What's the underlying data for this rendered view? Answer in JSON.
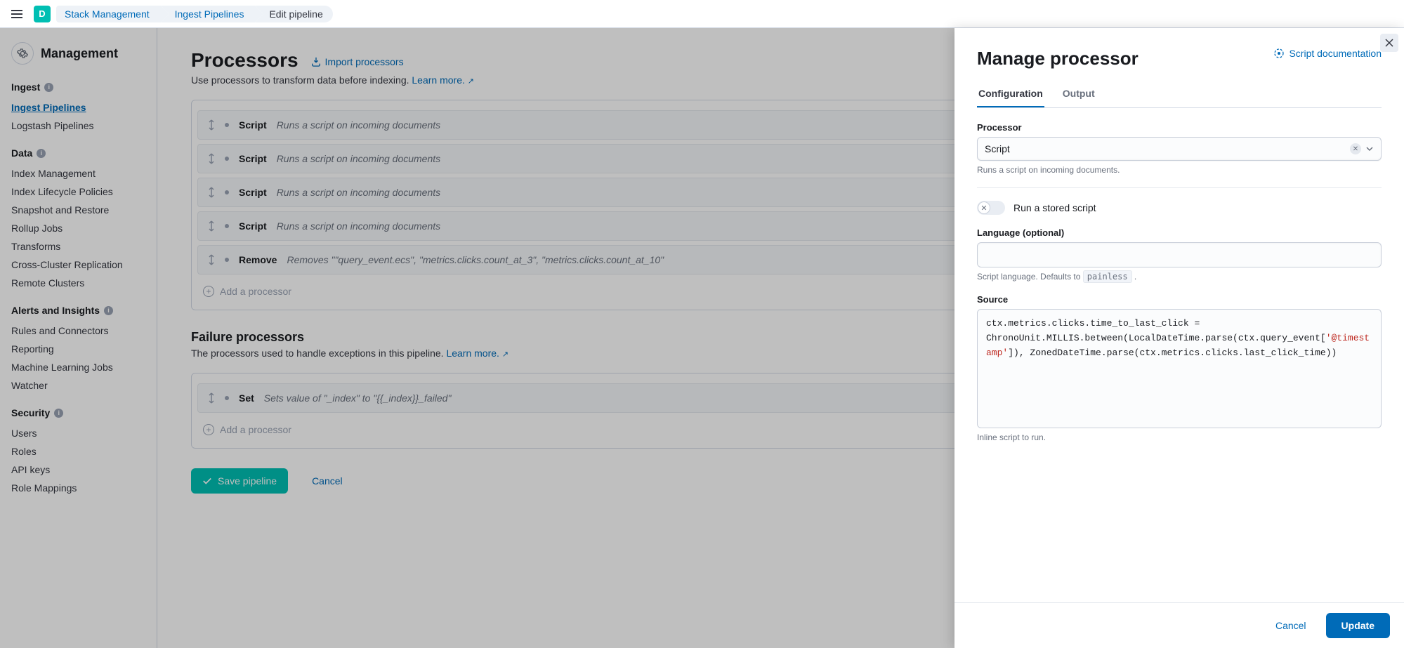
{
  "header": {
    "avatar_initial": "D",
    "crumbs": [
      "Stack Management",
      "Ingest Pipelines",
      "Edit pipeline"
    ]
  },
  "sidebar": {
    "heading": "Management",
    "sections": [
      {
        "title": "Ingest",
        "items": [
          "Ingest Pipelines",
          "Logstash Pipelines"
        ],
        "active_index": 0
      },
      {
        "title": "Data",
        "items": [
          "Index Management",
          "Index Lifecycle Policies",
          "Snapshot and Restore",
          "Rollup Jobs",
          "Transforms",
          "Cross-Cluster Replication",
          "Remote Clusters"
        ]
      },
      {
        "title": "Alerts and Insights",
        "items": [
          "Rules and Connectors",
          "Reporting",
          "Machine Learning Jobs",
          "Watcher"
        ]
      },
      {
        "title": "Security",
        "items": [
          "Users",
          "Roles",
          "API keys",
          "Role Mappings"
        ]
      }
    ]
  },
  "main": {
    "title": "Processors",
    "import_label": "Import processors",
    "subtitle_pre": "Use processors to transform data before indexing. ",
    "learn_more": "Learn more.",
    "processors": [
      {
        "name": "Script",
        "desc": "Runs a script on incoming documents"
      },
      {
        "name": "Script",
        "desc": "Runs a script on incoming documents"
      },
      {
        "name": "Script",
        "desc": "Runs a script on incoming documents"
      },
      {
        "name": "Script",
        "desc": "Runs a script on incoming documents"
      },
      {
        "name": "Remove",
        "desc": "Removes \"\"query_event.ecs\", \"metrics.clicks.count_at_3\", \"metrics.clicks.count_at_10\""
      }
    ],
    "add_processor": "Add a processor",
    "failure_title": "Failure processors",
    "failure_sub_pre": "The processors used to handle exceptions in this pipeline. ",
    "failure_processors": [
      {
        "name": "Set",
        "desc": "Sets value of \"_index\" to \"{{_index}}_failed\""
      }
    ],
    "save_btn": "Save pipeline",
    "cancel_btn": "Cancel"
  },
  "flyout": {
    "title": "Manage processor",
    "doc_link": "Script documentation",
    "tabs": {
      "config": "Configuration",
      "output": "Output"
    },
    "processor_label": "Processor",
    "processor_value": "Script",
    "processor_help": "Runs a script on incoming documents.",
    "switch_label": "Run a stored script",
    "lang_label": "Language (optional)",
    "lang_value": "",
    "lang_help_pre": "Script language. Defaults to ",
    "lang_help_code": "painless",
    "lang_help_post": " .",
    "source_label": "Source",
    "source_code_pre": "ctx.metrics.clicks.time_to_last_click = ChronoUnit.MILLIS.between(LocalDateTime.parse(ctx.query_event[",
    "source_code_str": "'@timestamp'",
    "source_code_post": "]), ZonedDateTime.parse(ctx.metrics.clicks.last_click_time))",
    "source_help": "Inline script to run.",
    "cancel": "Cancel",
    "update": "Update"
  }
}
